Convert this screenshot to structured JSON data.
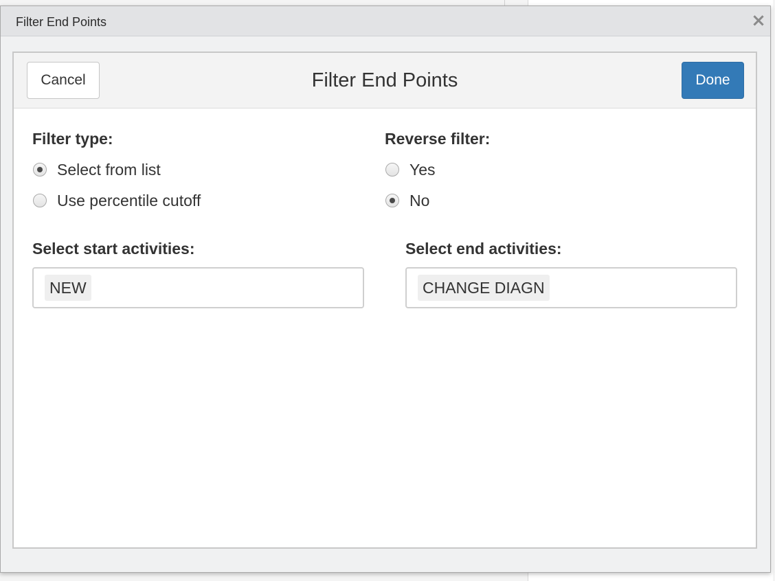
{
  "window": {
    "title": "Filter End Points",
    "close_symbol": "×"
  },
  "modal": {
    "title": "Filter End Points",
    "cancel_label": "Cancel",
    "done_label": "Done"
  },
  "filter_type": {
    "label": "Filter type:",
    "options": [
      {
        "label": "Select from list",
        "selected": true
      },
      {
        "label": "Use percentile cutoff",
        "selected": false
      }
    ]
  },
  "reverse_filter": {
    "label": "Reverse filter:",
    "options": [
      {
        "label": "Yes",
        "selected": false
      },
      {
        "label": "No",
        "selected": true
      }
    ]
  },
  "start_activities": {
    "label": "Select start activities:",
    "selected": [
      "NEW"
    ]
  },
  "end_activities": {
    "label": "Select end activities:",
    "selected": [
      "CHANGE DIAGN"
    ]
  },
  "colors": {
    "primary": "#337ab7",
    "titlebar": "#e2e3e5",
    "chip_bg": "#efefef"
  },
  "icons": {
    "close": "close-icon",
    "radio": "radio-button-icon"
  }
}
